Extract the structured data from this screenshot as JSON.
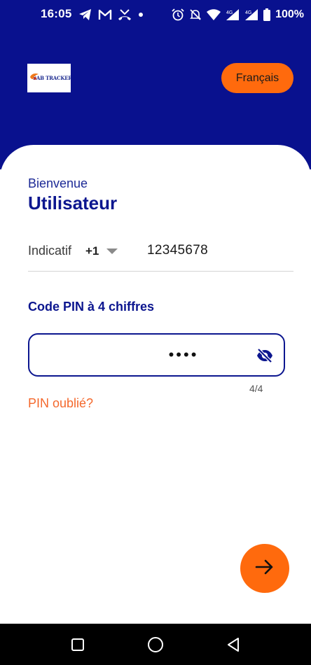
{
  "status_bar": {
    "time": "16:05",
    "left_icons": [
      "telegram-icon",
      "gmail-icon",
      "missed-call-icon",
      "dot-icon"
    ],
    "right_icons": [
      "alarm-icon",
      "mute-icon",
      "wifi-icon",
      "signal-4g-icon",
      "signal-4g-icon",
      "battery-icon"
    ],
    "network_1": "4G",
    "network_2": "4G",
    "battery": "100%"
  },
  "header": {
    "logo_text": "SAB TRACKER",
    "language_button": "Français"
  },
  "form": {
    "welcome": "Bienvenue",
    "username": "Utilisateur",
    "prefix_label": "Indicatif",
    "country_code": "+1",
    "phone_number": "12345678",
    "pin_label": "Code PIN à 4 chiffres",
    "pin_masked": "••••",
    "pin_counter": "4/4",
    "forgot_pin": "PIN oublié?"
  },
  "colors": {
    "primary": "#09118e",
    "accent": "#ff6a0d",
    "link": "#f4682c"
  }
}
